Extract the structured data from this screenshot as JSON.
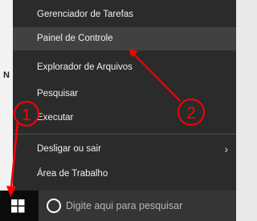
{
  "background_window": {
    "partial_letter": "N"
  },
  "menu": {
    "items": [
      {
        "label": "Gerenciador de Tarefas"
      },
      {
        "label": "Painel de Controle",
        "highlighted": true
      },
      {
        "label": "Explorador de Arquivos"
      },
      {
        "label": "Pesquisar"
      },
      {
        "label": "Executar"
      },
      {
        "label": "Desligar ou sair",
        "submenu": true
      },
      {
        "label": "Área de Trabalho"
      }
    ]
  },
  "taskbar": {
    "start_icon": "windows-logo-icon",
    "search": {
      "placeholder": "Digite aqui para pesquisar",
      "icon": "cortana-circle-icon"
    }
  },
  "annotations": {
    "color": "#ff0000",
    "markers": [
      {
        "number": "1"
      },
      {
        "number": "2"
      }
    ]
  },
  "colors": {
    "menu_background": "#2b2b2b",
    "menu_highlight": "#414141",
    "taskbar": "#0b0b0b",
    "search_bar": "#353535"
  }
}
